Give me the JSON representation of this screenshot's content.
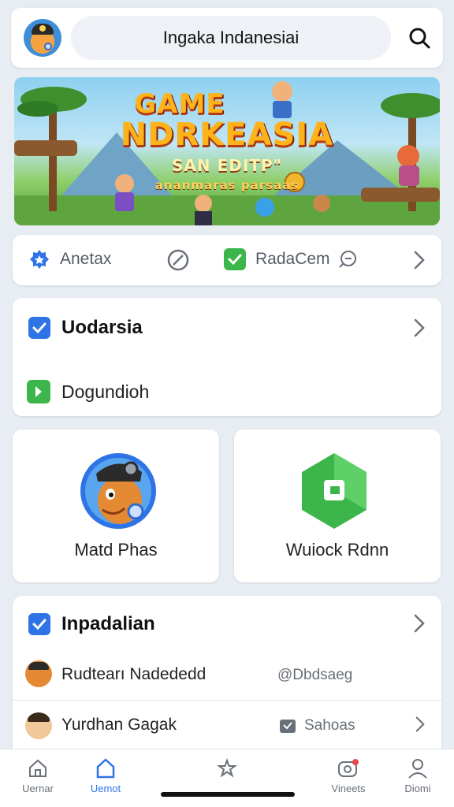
{
  "header": {
    "title": "Ingaka Indanesiai",
    "avatar_icon": "gamer-avatar-icon",
    "search_icon": "search-icon"
  },
  "banner": {
    "line1": "GAME",
    "line2": "NDRKEASIA",
    "line3": "SAN EDITP\"",
    "line4": "ananmaras parsaas"
  },
  "actions": {
    "item1": "Anetax",
    "item2": "RadaCem",
    "icons": [
      "star-badge-icon",
      "compass-icon",
      "check-icon",
      "chat-bubble-icon",
      "chevron-right-icon"
    ]
  },
  "section1": {
    "title": "Uodarsia",
    "row": "Dogundioh"
  },
  "tiles": [
    {
      "label": "Matd Phas",
      "icon": "character-avatar-icon"
    },
    {
      "label": "Wuiock Rdnn",
      "icon": "hexagon-app-icon"
    }
  ],
  "section2": {
    "title": "Inpadalian",
    "rows": [
      {
        "name": "Rudtearı Nadededd",
        "meta": "@Dbdsaeg"
      },
      {
        "name": "Yurdhan Gagak",
        "meta": "Sahoas"
      }
    ]
  },
  "nav": {
    "items": [
      {
        "label": "Uernar",
        "icon": "home-icon"
      },
      {
        "label": "Uemot",
        "icon": "house-outline-icon"
      },
      {
        "label": "",
        "icon": "star-sparkle-icon"
      },
      {
        "label": "Vineets",
        "icon": "notification-icon"
      },
      {
        "label": "Diomi",
        "icon": "profile-icon"
      }
    ]
  },
  "colors": {
    "accent": "#2f74e6",
    "green": "#3cb64a",
    "background": "#e8edf3"
  }
}
